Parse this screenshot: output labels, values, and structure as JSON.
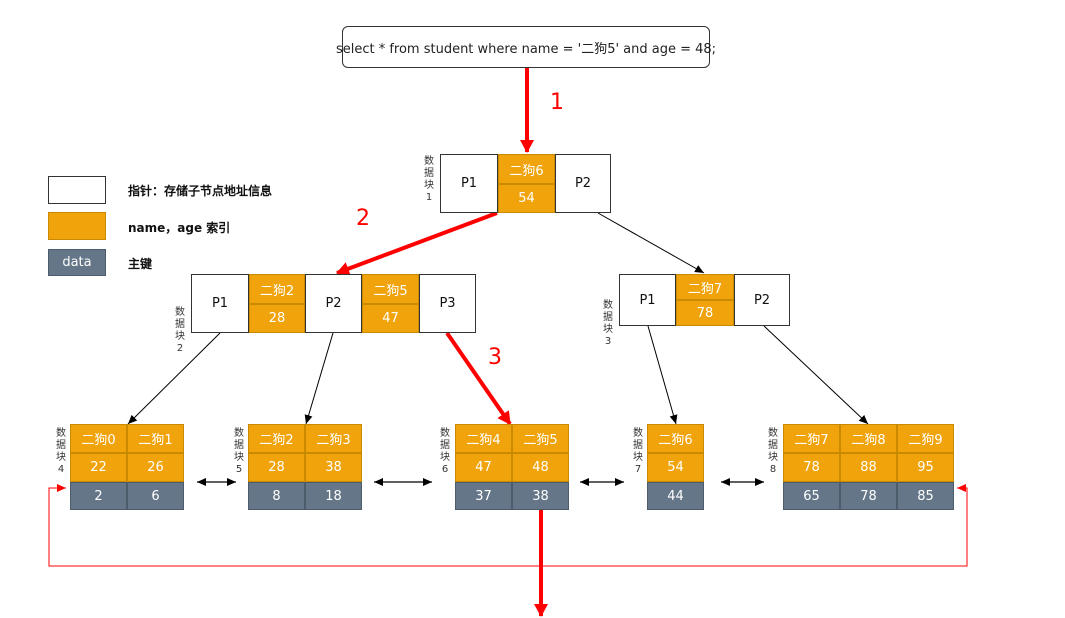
{
  "query": "select * from student where name = '二狗5' and age = 48;",
  "legend": [
    {
      "swatch_text": "",
      "label": "指针：存储子节点地址信息"
    },
    {
      "swatch_text": "",
      "label": "name，age 索引"
    },
    {
      "swatch_text": "data",
      "label": "主键"
    }
  ],
  "steps": [
    "1",
    "2",
    "3"
  ],
  "blocks": {
    "b1": {
      "label": "数据块1",
      "p": [
        "P1",
        "P2"
      ],
      "name": "二狗6",
      "age": "54"
    },
    "b2": {
      "label": "数据块2",
      "p": [
        "P1",
        "P2",
        "P3"
      ],
      "keys": [
        {
          "name": "二狗2",
          "age": "28"
        },
        {
          "name": "二狗5",
          "age": "47"
        }
      ]
    },
    "b3": {
      "label": "数据块3",
      "p": [
        "P1",
        "P2"
      ],
      "name": "二狗7",
      "age": "78"
    },
    "b4": {
      "label": "数据块4",
      "names": [
        "二狗0",
        "二狗1"
      ],
      "ages": [
        "22",
        "26"
      ],
      "ids": [
        "2",
        "6"
      ]
    },
    "b5": {
      "label": "数据块5",
      "names": [
        "二狗2",
        "二狗3"
      ],
      "ages": [
        "28",
        "38"
      ],
      "ids": [
        "8",
        "18"
      ]
    },
    "b6": {
      "label": "数据块6",
      "names": [
        "二狗4",
        "二狗5"
      ],
      "ages": [
        "47",
        "48"
      ],
      "ids": [
        "37",
        "38"
      ]
    },
    "b7": {
      "label": "数据块7",
      "names": [
        "二狗6"
      ],
      "ages": [
        "54"
      ],
      "ids": [
        "44"
      ]
    },
    "b8": {
      "label": "数据块8",
      "names": [
        "二狗7",
        "二狗8",
        "二狗9"
      ],
      "ages": [
        "78",
        "88",
        "95"
      ],
      "ids": [
        "65",
        "78",
        "85"
      ]
    }
  },
  "colors": {
    "pointer": "#ffffff",
    "index": "#f0a30a",
    "primary_key": "#647687",
    "arrow_red": "#ff0000"
  }
}
